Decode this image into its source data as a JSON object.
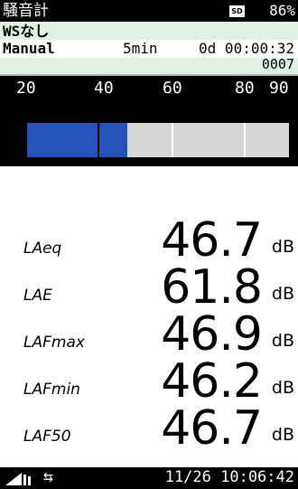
{
  "status": {
    "app_title": "騒音計",
    "sd_label": "SD",
    "battery": "86%"
  },
  "info": {
    "wind_screen": "WSなし",
    "mode": "Manual",
    "interval": "5min",
    "elapsed": "0d 00:00:32",
    "counter": "0007"
  },
  "meter": {
    "scale_labels": [
      "20",
      "40",
      "60",
      "80",
      "90"
    ],
    "level_db": 46.7,
    "range": [
      20,
      90
    ],
    "fill_color": "#2452b8",
    "track_color": "#d6d6d6"
  },
  "readings": [
    {
      "label": "LAeq",
      "value": "46.7",
      "unit": "dB"
    },
    {
      "label": "LAE",
      "value": "61.8",
      "unit": "dB"
    },
    {
      "label": "LAFmax",
      "value": "46.9",
      "unit": "dB"
    },
    {
      "label": "LAFmin",
      "value": "46.2",
      "unit": "dB"
    },
    {
      "label": "LAF50",
      "value": "46.7",
      "unit": "dB"
    }
  ],
  "bottom": {
    "signal_icon": "signal-icon",
    "swap_icon": "swap-arrows-icon",
    "swap_glyph": "⇆",
    "datetime": "11/26 10:06:42"
  }
}
